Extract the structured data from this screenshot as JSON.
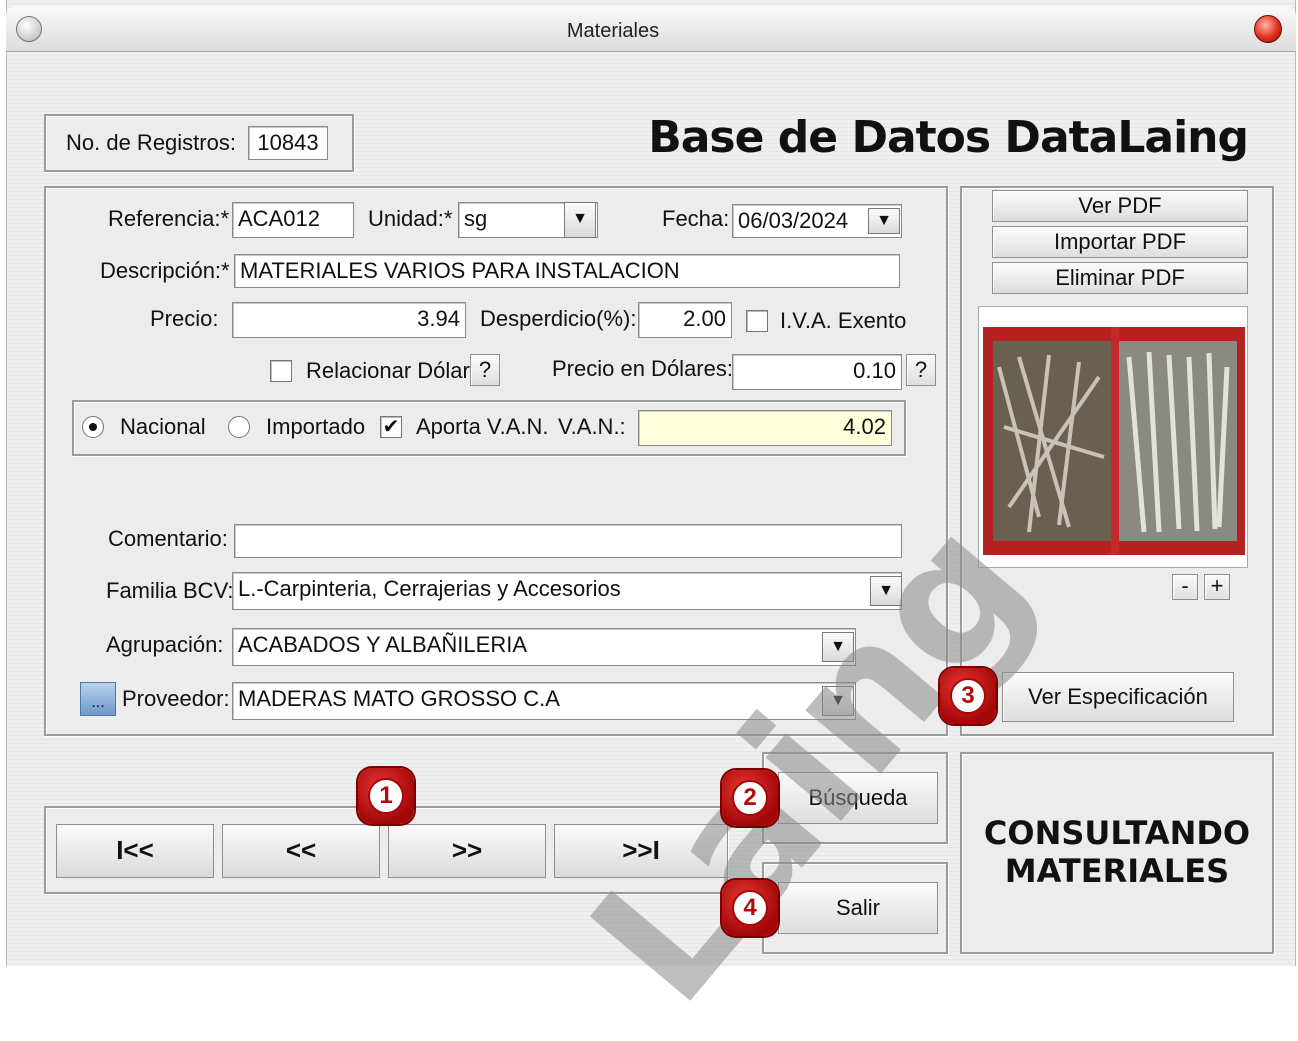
{
  "window": {
    "title": "Materiales"
  },
  "header": {
    "records_label": "No. de Registros:",
    "records_value": "10843",
    "app_title": "Base de Datos DataLaing"
  },
  "form": {
    "referencia_label": "Referencia:*",
    "referencia_value": "ACA012",
    "unidad_label": "Unidad:*",
    "unidad_value": "sg",
    "fecha_label": "Fecha:",
    "fecha_value": "06/03/2024",
    "descripcion_label": "Descripción:*",
    "descripcion_value": "MATERIALES VARIOS PARA INSTALACION",
    "precio_label": "Precio:",
    "precio_value": "3.94",
    "desperdicio_label": "Desperdicio(%):",
    "desperdicio_value": "2.00",
    "iva_label": "I.V.A. Exento",
    "relacionar_label": "Relacionar Dólar",
    "help_label": "?",
    "precio_dolares_label": "Precio en Dólares:",
    "precio_dolares_value": "0.10",
    "nacional_label": "Nacional",
    "importado_label": "Importado",
    "aporta_label": "Aporta V.A.N.",
    "van_label": "V.A.N.:",
    "van_value": "4.02",
    "comentario_label": "Comentario:",
    "comentario_value": "",
    "familia_label": "Familia BCV:",
    "familia_value": "L.-Carpinteria, Cerrajerias y Accesorios",
    "agrupacion_label": "Agrupación:",
    "agrupacion_value": "ACABADOS Y ALBAÑILERIA",
    "proveedor_label": "Proveedor:",
    "proveedor_value": "MADERAS MATO GROSSO C.A",
    "proveedor_btn": "..."
  },
  "pdf": {
    "ver": "Ver PDF",
    "importar": "Importar PDF",
    "eliminar": "Eliminar PDF",
    "zoom_out": "-",
    "zoom_in": "+"
  },
  "nav": {
    "first": "I<<",
    "prev": "<<",
    "next": ">>",
    "last": ">>I"
  },
  "actions": {
    "busqueda": "Búsqueda",
    "salir": "Salir",
    "ver_especificacion": "Ver Especificación"
  },
  "status": {
    "line1": "CONSULTANDO",
    "line2": "MATERIALES"
  },
  "badges": {
    "b1": "1",
    "b2": "2",
    "b3": "3",
    "b4": "4"
  },
  "watermark": "Laing",
  "icons": {
    "dropdown": "triangle-down",
    "check": "✔"
  }
}
